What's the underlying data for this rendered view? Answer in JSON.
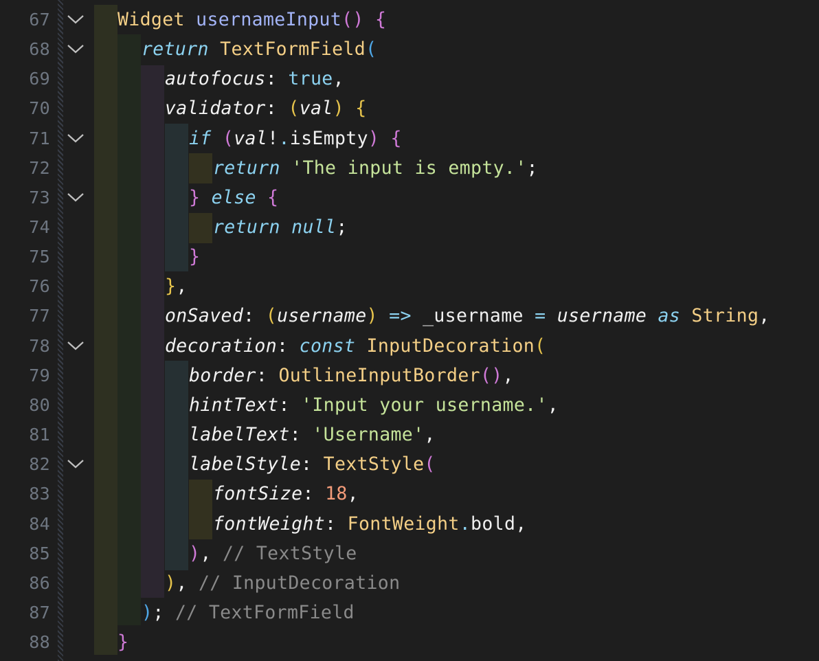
{
  "editor": {
    "line_numbers": [
      "67",
      "68",
      "69",
      "70",
      "71",
      "72",
      "73",
      "74",
      "75",
      "76",
      "77",
      "78",
      "79",
      "80",
      "81",
      "82",
      "83",
      "84",
      "85",
      "86",
      "87",
      "88"
    ],
    "fold_markers_on_lines": [
      "67",
      "68",
      "71",
      "73",
      "78",
      "82"
    ],
    "fold_icon": "chevron-down-icon",
    "colors": {
      "background": "#1e1e1e",
      "line_number": "#6e7681",
      "type": "#f4cf86",
      "function": "#a3b4f7",
      "keyword": "#8cd2f0",
      "string": "#c5e39a",
      "number": "#f49c7a",
      "comment": "#8a8a8a",
      "bracket_level_1": "#e7c44c",
      "bracket_level_2": "#d07ad8",
      "bracket_level_3": "#4fa8e8"
    },
    "code": {
      "l67": {
        "type": "Widget",
        "name": "usernameInput",
        "parens": "()",
        "brace": "{"
      },
      "l68": {
        "kw": "return",
        "cls": "TextFormField",
        "paren": "("
      },
      "l69": {
        "prop": "autofocus",
        "colon": ":",
        "value": "true",
        "comma": ","
      },
      "l70": {
        "prop": "validator",
        "colon": ":",
        "open": "(",
        "param": "val",
        "close": ")",
        "brace": "{"
      },
      "l71": {
        "kw": "if",
        "open": "(",
        "var": "val",
        "bang": "!",
        "dot": ".",
        "member": "isEmpty",
        "close": ")",
        "brace": "{"
      },
      "l72": {
        "kw": "return",
        "str": "'The input is empty.'",
        "semi": ";"
      },
      "l73": {
        "close": "}",
        "kw": "else",
        "open": "{"
      },
      "l74": {
        "kw": "return",
        "value": "null",
        "semi": ";"
      },
      "l75": {
        "close": "}"
      },
      "l76": {
        "close": "}",
        "comma": ","
      },
      "l77": {
        "prop": "onSaved",
        "colon": ":",
        "open": "(",
        "param": "username",
        "close": ")",
        "arrow": "=>",
        "field": "_username",
        "eq": "=",
        "param2": "username",
        "as": "as",
        "type": "String",
        "comma": ","
      },
      "l78": {
        "prop": "decoration",
        "colon": ":",
        "kw": "const",
        "cls": "InputDecoration",
        "open": "("
      },
      "l79": {
        "prop": "border",
        "colon": ":",
        "cls": "OutlineInputBorder",
        "parens": "()",
        "comma": ","
      },
      "l80": {
        "prop": "hintText",
        "colon": ":",
        "str": "'Input your username.'",
        "comma": ","
      },
      "l81": {
        "prop": "labelText",
        "colon": ":",
        "str": "'Username'",
        "comma": ","
      },
      "l82": {
        "prop": "labelStyle",
        "colon": ":",
        "cls": "TextStyle",
        "open": "("
      },
      "l83": {
        "prop": "fontSize",
        "colon": ":",
        "num": "18",
        "comma": ","
      },
      "l84": {
        "prop": "fontWeight",
        "colon": ":",
        "cls": "FontWeight",
        "dot": ".",
        "member": "bold",
        "comma": ","
      },
      "l85": {
        "close": ")",
        "comma": ",",
        "comment": "// TextStyle"
      },
      "l86": {
        "close": ")",
        "comma": ",",
        "comment": "// InputDecoration"
      },
      "l87": {
        "close": ")",
        "semi": ";",
        "comment": "// TextFormField"
      },
      "l88": {
        "close": "}"
      }
    }
  }
}
